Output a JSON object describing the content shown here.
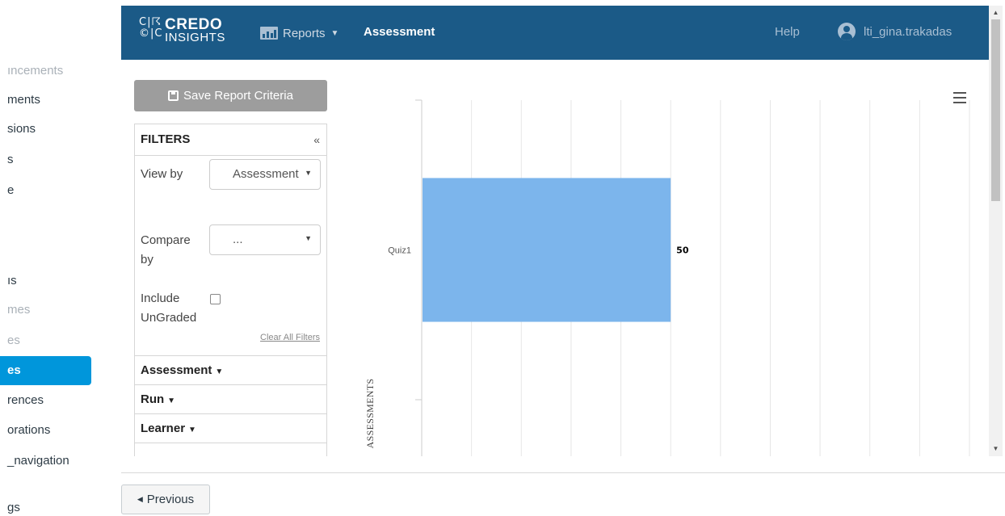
{
  "lms_nav": {
    "items": [
      {
        "label": "ıncements",
        "style": "dim"
      },
      {
        "label": "ments",
        "style": "normal"
      },
      {
        "label": "sions",
        "style": "normal"
      },
      {
        "label": "s",
        "style": "normal"
      },
      {
        "label": "e",
        "style": "normal"
      },
      {
        "label": "ıs",
        "style": "normal"
      },
      {
        "label": "mes",
        "style": "dim"
      },
      {
        "label": "es",
        "style": "dim"
      },
      {
        "label": "es",
        "style": "active"
      },
      {
        "label": "rences",
        "style": "normal"
      },
      {
        "label": "orations",
        "style": "normal"
      },
      {
        "label": "_navigation",
        "style": "normal"
      },
      {
        "label": "gs",
        "style": "normal"
      }
    ]
  },
  "header": {
    "logo_mark": "C|C\n©|C",
    "logo_brand": "CREDO",
    "logo_sub": "INSIGHTS",
    "reports_label": "Reports",
    "reports_icon": "bar-chart-icon",
    "breadcrumb": "Assessment",
    "help_label": "Help",
    "user_name": "lti_gina.trakadas",
    "user_icon": "user-circle-icon"
  },
  "toolbar": {
    "save_label": "Save Report Criteria"
  },
  "filters": {
    "title": "FILTERS",
    "collapse_glyph": "«",
    "view_by_label": "View by",
    "view_by_value": "Assessment",
    "compare_by_label": "Compare by",
    "compare_by_value": "...",
    "include_ungraded_label": "Include UnGraded",
    "include_ungraded_checked": false,
    "clear_label": "Clear All Filters",
    "sections": [
      "Assessment",
      "Run",
      "Learner"
    ]
  },
  "chart_data": {
    "type": "bar",
    "orientation": "horizontal",
    "categories": [
      "Quiz1"
    ],
    "values": [
      50
    ],
    "data_labels": [
      "50"
    ],
    "xlim": [
      0,
      110
    ],
    "xlabel": "",
    "ylabel": "ASSESSMENTS",
    "bar_color": "#7cb5ec",
    "grid": true
  },
  "footer": {
    "previous_label": "Previous"
  },
  "colors": {
    "header_bg": "#1b5a87",
    "active_nav": "#0096db",
    "save_button_bg": "#9d9d9d"
  }
}
